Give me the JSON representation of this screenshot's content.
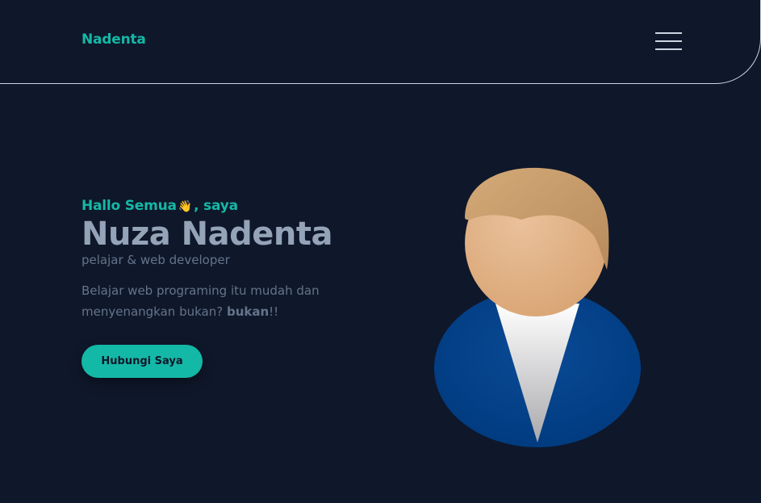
{
  "navbar": {
    "brand": "Nadenta",
    "menu_icon": "hamburger-menu-icon"
  },
  "hero": {
    "greeting_before": "Hallo Semua",
    "greeting_emoji": "👋",
    "greeting_after": ", saya",
    "name": "Nuza Nadenta",
    "role": "pelajar & web developer",
    "desc_before": "Belajar web programing itu mudah dan menyenangkan bukan? ",
    "desc_bold": "bukan",
    "desc_after": "!!",
    "cta_label": "Hubungi Saya",
    "avatar_icon": "person-avatar-icon"
  },
  "colors": {
    "background": "#0f172a",
    "accent": "#14b8a6",
    "heading": "#94a3b8",
    "body_text": "#64748b",
    "avatar_suit": "#003f87",
    "avatar_skin": "#e2b48d",
    "avatar_hair": "#c49a6c"
  }
}
